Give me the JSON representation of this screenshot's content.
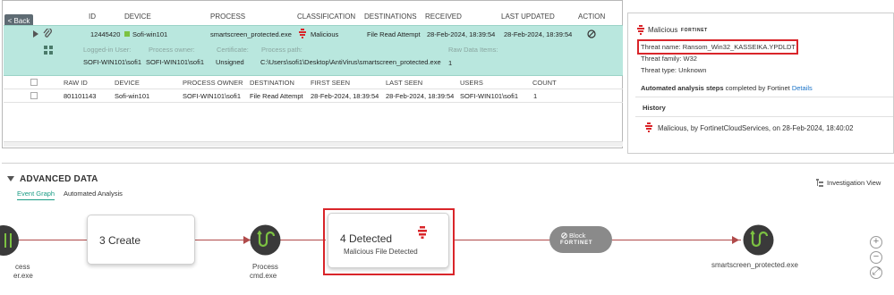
{
  "events_table": {
    "back_label": "< Back",
    "headers": {
      "id": "ID",
      "device": "DEVICE",
      "process": "PROCESS",
      "classification": "CLASSIFICATION",
      "destinations": "DESTINATIONS",
      "received": "RECEIVED",
      "last_updated": "LAST UPDATED",
      "action": "ACTION"
    },
    "main_row": {
      "id": "12445420",
      "device": "Sofi-win101",
      "process": "smartscreen_protected.exe",
      "classification": "Malicious",
      "destination": "File Read Attempt",
      "received": "28-Feb-2024, 18:39:54",
      "last_updated": "28-Feb-2024, 18:39:54"
    },
    "detail_labels": {
      "logged_in_user": "Logged-in User:",
      "process_owner": "Process owner:",
      "certificate": "Certificate:",
      "process_path": "Process path:",
      "raw_data_items": "Raw Data Items:"
    },
    "detail_values": {
      "logged_in_user": "SOFI-WIN101\\sofi1",
      "process_owner": "SOFI-WIN101\\sofi1",
      "certificate": "Unsigned",
      "process_path": "C:\\Users\\sofi1\\Desktop\\AntiVirus\\smartscreen_protected.exe",
      "raw_data_items": "1"
    },
    "sub_headers": {
      "raw_id": "RAW ID",
      "device": "DEVICE",
      "process_owner": "PROCESS OWNER",
      "destination": "DESTINATION",
      "first_seen": "FIRST SEEN",
      "last_seen": "LAST SEEN",
      "users": "USERS",
      "count": "COUNT"
    },
    "sub_row": {
      "raw_id": "801101143",
      "device": "Sofi-win101",
      "process_owner": "SOFI-WIN101\\sofi1",
      "destination": "File Read Attempt",
      "first_seen": "28-Feb-2024, 18:39:54",
      "last_seen": "28-Feb-2024, 18:39:54",
      "users": "SOFI-WIN101\\sofi1",
      "count": "1"
    }
  },
  "details": {
    "classification": "Malicious",
    "vendor_logo": "FORTINET",
    "threat_name": "Threat name: Ransom_Win32_KASSEIKA.YPDLDT",
    "threat_family": "Threat family: W32",
    "threat_type": "Threat type: Unknown",
    "analysis_bold": "Automated analysis steps",
    "analysis_rest": " completed by Fortinet ",
    "analysis_link": "Details",
    "history_title": "History",
    "history_entry": "Malicious, by FortinetCloudServices, on 28-Feb-2024, 18:40:02"
  },
  "advanced": {
    "title": "ADVANCED DATA",
    "tabs": [
      "Event Graph",
      "Automated Analysis"
    ],
    "investigation_view": "Investigation View",
    "left_node_label_1": "cess",
    "left_node_label_2": "er.exe",
    "create_label": "3 Create",
    "process_label": "Process",
    "process_name": "cmd.exe",
    "detected_label": "4 Detected",
    "detected_sub": "Malicious File Detected",
    "block_label": "Block",
    "block_vendor": "FORTINET",
    "target_label": "smartscreen_protected.exe"
  },
  "colors": {
    "accent_teal": "#1b9c85",
    "row_highlight": "#b9e7de",
    "malicious_red": "#d9252a",
    "node_dark": "#3a3a3a",
    "node_green": "#7cc242"
  }
}
